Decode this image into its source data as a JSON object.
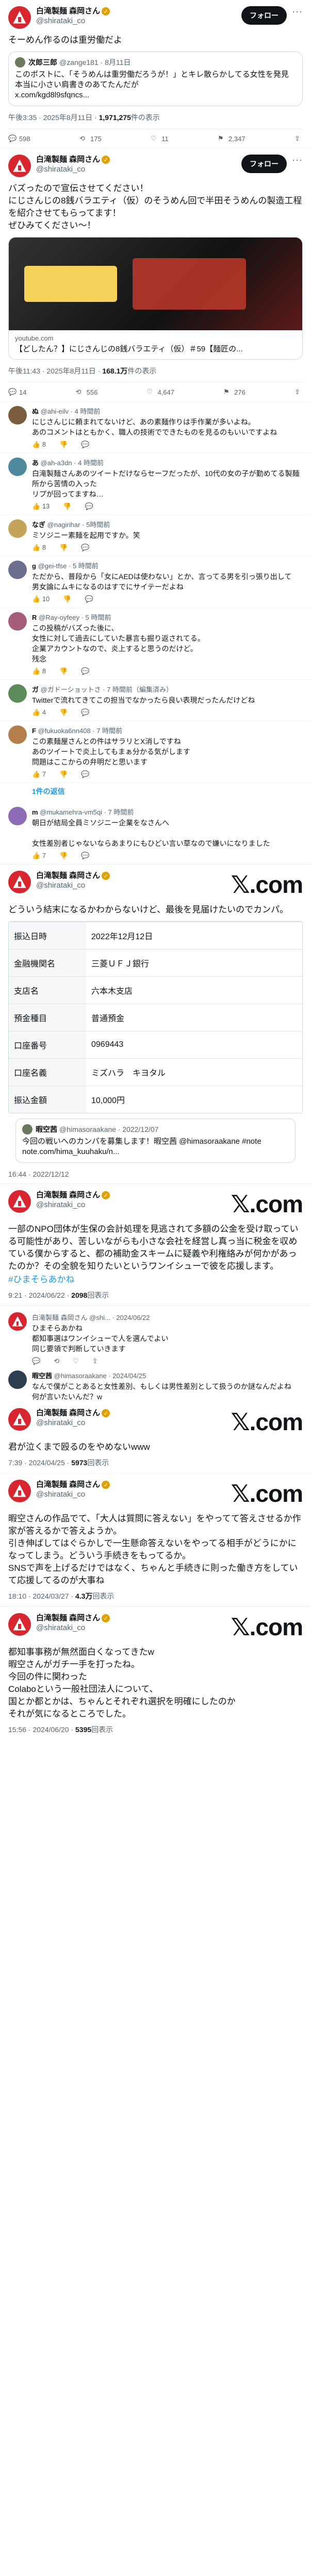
{
  "main_post": {
    "name": "白滝製麺 森岡さん",
    "handle": "@shirataki_co",
    "follow_label": "フォロー",
    "text": "そーめん作るのは重労働だよ",
    "quote": {
      "name": "次郎三郎",
      "handle": "@zange181 · 8月11日",
      "text": "このポストに、「そうめんは重労働だろうが！」とキレ散らかしてる女性を発見\n本当に小さい肩書きのあてたんだが\nx.com/kgd8l9sfqncs..."
    },
    "meta_time": "午後3:35 · 2025年8月11日 · ",
    "meta_views": "1,971,275",
    "meta_views_label": "件の表示",
    "stats": {
      "replies": "598",
      "reposts": "175",
      "likes": "11",
      "bookmarks": "2,347"
    }
  },
  "post2": {
    "name": "白滝製麺 森岡さん",
    "handle": "@shirataki_co",
    "follow_label": "フォロー",
    "text": "バズったので宣伝させてください！\nにじさんじの8銭バラエティ（仮）のそうめん回で半田そうめんの製造工程を紹介させてもらってます！\nぜひみてください～！",
    "card_domain": "youtube.com",
    "card_title": "【どしたん？】にじさんじの8銭バラエティ（仮）＃59【麺匠の...",
    "meta_time": "午後11:43 · 2025年8月11日 · ",
    "meta_views": "168.1万",
    "meta_views_label": "件の表示",
    "stats": {
      "replies": "14",
      "reposts": "556",
      "likes": "4,647",
      "bookmarks": "276"
    }
  },
  "replies": [
    {
      "name": "ぬ",
      "handle": "@ahi-eilv · 4 時間前",
      "text": "にじさんじに頼まれてないけど、あの素麺作りは手作業が多いよね。\nあのコメントはともかく、職人の技術でできたものを見るのもいいですよね",
      "likes": "8"
    },
    {
      "name": "あ",
      "handle": "@ah-a3dn · 4 時間前",
      "text": "白滝製麺さんあのツイートだけならセーフだったが、10代の女の子が勤めてる製麺所から苦情の入った\nリプが回ってますね…",
      "likes": "13"
    },
    {
      "name": "なぎ",
      "handle": "@nagirihar · 5時間前",
      "text": "ミソジニー素麺を起用ですか。笑",
      "likes": "8"
    },
    {
      "name": "g",
      "handle": "@gei-tfse · 5 時間前",
      "text": "ただから、普段から「女にAEDは使わない」とか、言ってる男を引っ張り出して\n男女論にムキになるのはすでにサイテーだよね",
      "likes": "10"
    },
    {
      "name": "R",
      "handle": "@Ray-oyfeey · 5 時間前",
      "text": "この投稿がバズった後に、\n女性に対して過去にしていた暴言も掘り返されてる。\n企業アカウントなので、炎上すると思うのだけど。\n残念",
      "likes": "8"
    },
    {
      "name": "ガ",
      "handle": "@ガドーショットさ · 7 時間前（編集済み）",
      "text": "Twitterで流れてきてこの担当でなかったら良い表現だったんだけどね",
      "likes": "4"
    },
    {
      "name": "F",
      "handle": "@fukuoka6nn408 · 7 時間前",
      "text": "この素麺屋さんとの件はサラリとX消しですね\nあのツイートで炎上してもまぁ分かる気がします\n問題はここからの弁明だと思います",
      "likes": "7"
    }
  ],
  "show_one_reply": "1件の返信",
  "reply_extra": {
    "name": "m",
    "handle": "@mukamehra-vm5qi · 7 時間前",
    "text": "朝日が結局全員ミソジニー企業をなさんへ\n\n女性差別者じゃないならあまりにもひどい言い草なので嫌いになりました",
    "likes": "7"
  },
  "post3": {
    "name": "白滝製麺 森岡さん",
    "handle": "@shirataki_co",
    "text": "どういう結末になるかわからないけど、最後を見届けたいのでカンパ。",
    "table": [
      [
        "振込日時",
        "2022年12月12日"
      ],
      [
        "金融機関名",
        "三菱ＵＦＪ銀行"
      ],
      [
        "支店名",
        "六本木支店"
      ],
      [
        "預金種目",
        "普通預金"
      ],
      [
        "口座番号",
        "0969443"
      ],
      [
        "口座名義",
        "ミズハラ　キヨタル"
      ],
      [
        "振込金額",
        "10,000円"
      ]
    ],
    "quote_name": "暇空茜",
    "quote_handle": "@himasoraakane · 2022/12/07",
    "quote_text": "今回の戦いへのカンパを募集します！暇空茜 @himasoraakane #note note.com/hima_kuuhaku/n...",
    "time": "16:44 · 2022/12/12"
  },
  "post4": {
    "text": "一部のNPO団体が生保の会計処理を見逃されて多額の公金を受け取っている可能性があり、苦しいながらも小さな会社を経営し真っ当に税金を収めている僕からすると、都の補助金スキームに疑義や利権絡みが何かがあったのか？その全貌を知りたいというワンイシューで彼を応援します。",
    "hashtag": "#ひまそらあかね",
    "time": "9:21 · 2024/06/22 · ",
    "views": "2098",
    "views_label": "回表示"
  },
  "post5": {
    "reply_header": "白滝製麺 森岡さん @shi... · 2024/06/22",
    "reply_text": "ひまそらあかね\n都知事選はワンイシューで人を選んでよい\n同じ要領で判断していきます",
    "reply2_name": "暇空茜",
    "reply2_handle": "@himasoraakane · 2024/04/25",
    "reply2_text": "なんで僕がことあると女性差別、もしくは男性差別として扱うのか謎なんだよね\n何が言いたいんだ？w",
    "main_name": "白滝製麺 森岡さん",
    "main_handle": "@shirataki_co",
    "main_text": "君が泣くまで殴るのをやめないwww",
    "time": "7:39 · 2024/04/25 · ",
    "views": "5973",
    "views_label": "回表示"
  },
  "post6": {
    "name": "白滝製麺 森岡さん",
    "handle": "@shirataki_co",
    "text": "暇空さんの作品でて、「大人は質問に答えない」をやってて答えさせるか作家が答えるかで答えようか。\n引き伸ばしてはぐらかしで一生懸命答えないをやってる相手がどうにかになってしまう。どういう手続きをもってるか。\nSNSで声を上げるだけではなく、ちゃんと手続きに則った働き方をしていて応援してるのが大事ね",
    "time": "18:10 · 2024/03/27 · ",
    "views": "4.3万",
    "views_label": "回表示"
  },
  "post7": {
    "text": "都知事事務が無然面白くなってきたw\n暇空さんがガチ一手を打ったね。\n今回の件に関わった\nColaboという一般社団法人について、\n国とか都とかは、ちゃんとそれぞれ選択を明確にしたのか\nそれが気になるところでした。",
    "time": "15:56 · 2024/06/20 · ",
    "views": "5395",
    "views_label": "回表示"
  },
  "icons": {
    "reply": "reply-icon",
    "repost": "repost-icon",
    "like": "heart-icon",
    "views": "views-icon",
    "bookmark": "bookmark-icon",
    "share": "share-icon"
  }
}
